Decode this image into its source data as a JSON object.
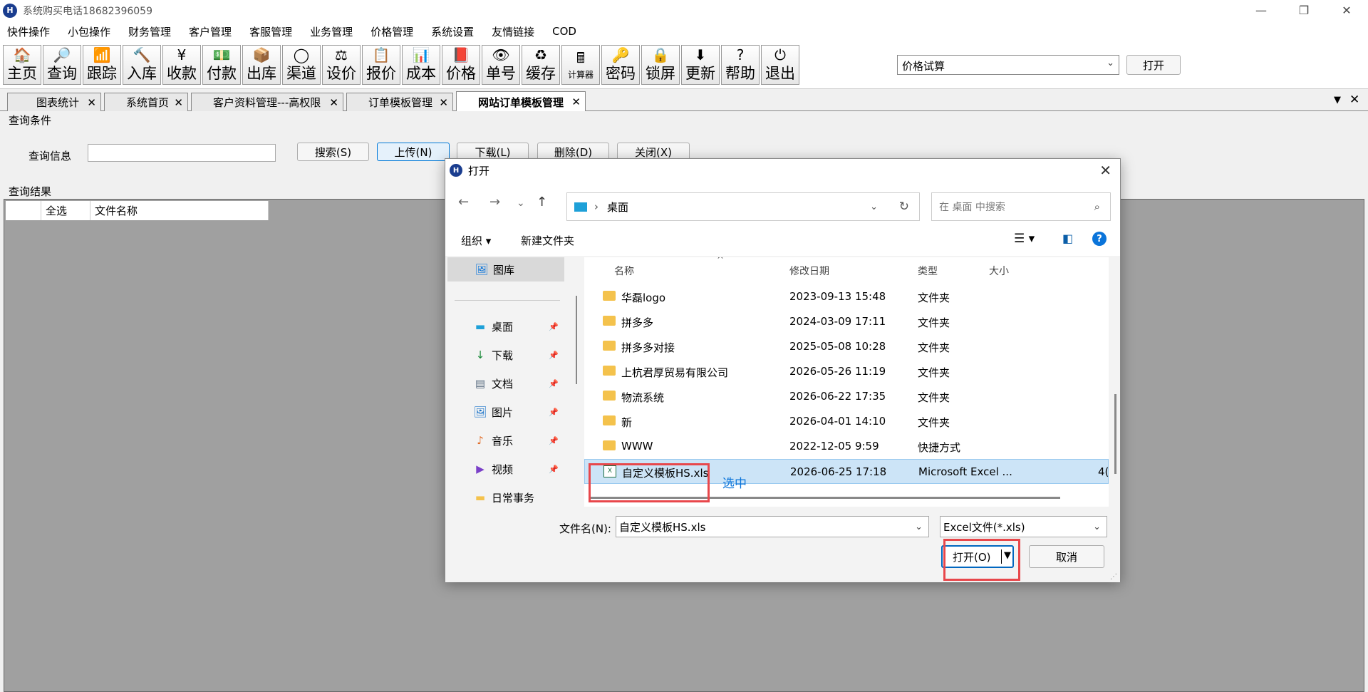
{
  "window": {
    "title": "系统购买电话18682396059",
    "logo": "H"
  },
  "menu": [
    "快件操作",
    "小包操作",
    "财务管理",
    "客户管理",
    "客服管理",
    "业务管理",
    "价格管理",
    "系统设置",
    "友情链接",
    "COD"
  ],
  "toolbar": {
    "buttons": [
      {
        "label": "主页",
        "icon": "house-icon",
        "glyph": "🏠"
      },
      {
        "label": "查询",
        "icon": "magnifier-icon",
        "glyph": "🔎"
      },
      {
        "label": "跟踪",
        "icon": "signal-icon",
        "glyph": "📶"
      },
      {
        "label": "入库",
        "icon": "hammer-icon",
        "glyph": "🔨"
      },
      {
        "label": "收款",
        "icon": "yen-icon",
        "glyph": "¥"
      },
      {
        "label": "付款",
        "icon": "money-icon",
        "glyph": "💵"
      },
      {
        "label": "出库",
        "icon": "box-icon",
        "glyph": "📦"
      },
      {
        "label": "渠道",
        "icon": "channel-icon",
        "glyph": "◯"
      },
      {
        "label": "设价",
        "icon": "scale-icon",
        "glyph": "⚖"
      },
      {
        "label": "报价",
        "icon": "quote-icon",
        "glyph": "📋"
      },
      {
        "label": "成本",
        "icon": "bar-chart-icon",
        "glyph": "📊"
      },
      {
        "label": "价格",
        "icon": "price-icon",
        "glyph": "📕"
      },
      {
        "label": "单号",
        "icon": "eye-icon",
        "glyph": "👁"
      },
      {
        "label": "缓存",
        "icon": "refresh-icon",
        "glyph": "♻"
      },
      {
        "label": "计算器",
        "icon": "calculator-icon",
        "glyph": "🖩"
      },
      {
        "label": "密码",
        "icon": "key-icon",
        "glyph": "🔑"
      },
      {
        "label": "锁屏",
        "icon": "lock-icon",
        "glyph": "🔒"
      },
      {
        "label": "更新",
        "icon": "download-arrow-icon",
        "glyph": "⬇"
      },
      {
        "label": "帮助",
        "icon": "help-icon",
        "glyph": "?"
      },
      {
        "label": "退出",
        "icon": "power-icon",
        "glyph": "⏻"
      }
    ],
    "combo_value": "价格试算",
    "open_button": "打开"
  },
  "tabs": [
    {
      "label": "图表统计"
    },
    {
      "label": "系统首页"
    },
    {
      "label": "客户资料管理---高权限"
    },
    {
      "label": "订单模板管理"
    },
    {
      "label": "网站订单模板管理"
    }
  ],
  "query": {
    "section_title": "查询条件",
    "info_label": "查询信息",
    "info_value": "",
    "buttons": [
      "搜索(S)",
      "上传(N)",
      "下载(L)",
      "删除(D)",
      "关闭(X)"
    ],
    "result_title": "查询结果",
    "columns": [
      "全选",
      "文件名称"
    ]
  },
  "dialog": {
    "title": "打开",
    "path": "桌面",
    "search_placeholder": "在 桌面 中搜索",
    "organize": "组织 ▾",
    "new_folder": "新建文件夹",
    "sidebar": [
      {
        "label": "图库",
        "icon": "gallery-icon",
        "glyph": "🖼",
        "pinned": false
      },
      {
        "label": "桌面",
        "icon": "desktop-icon",
        "glyph": "▬",
        "pinned": true
      },
      {
        "label": "下载",
        "icon": "download-icon",
        "glyph": "↓",
        "pinned": true
      },
      {
        "label": "文档",
        "icon": "document-icon",
        "glyph": "▤",
        "pinned": true
      },
      {
        "label": "图片",
        "icon": "picture-icon",
        "glyph": "🖼",
        "pinned": true
      },
      {
        "label": "音乐",
        "icon": "music-icon",
        "glyph": "♪",
        "pinned": true
      },
      {
        "label": "视频",
        "icon": "video-icon",
        "glyph": "▶",
        "pinned": true
      },
      {
        "label": "日常事务",
        "icon": "folder-icon",
        "glyph": "▬",
        "pinned": false
      }
    ],
    "columns": [
      "名称",
      "修改日期",
      "类型",
      "大小"
    ],
    "files": [
      {
        "name": "华磊logo",
        "date": "2023-09-13 15:48",
        "type": "文件夹",
        "size": ""
      },
      {
        "name": "拼多多",
        "date": "2024-03-09 17:11",
        "type": "文件夹",
        "size": ""
      },
      {
        "name": "拼多多对接",
        "date": "2025-05-08 10:28",
        "type": "文件夹",
        "size": ""
      },
      {
        "name": "上杭君厚贸易有限公司",
        "date": "2026-05-26 11:19",
        "type": "文件夹",
        "size": ""
      },
      {
        "name": "物流系统",
        "date": "2026-06-22 17:35",
        "type": "文件夹",
        "size": ""
      },
      {
        "name": "新",
        "date": "2026-04-01 14:10",
        "type": "文件夹",
        "size": ""
      },
      {
        "name": "WWW",
        "date": "2022-12-05 9:59",
        "type": "快捷方式",
        "size": ""
      },
      {
        "name": "自定义模板HS.xls",
        "date": "2026-06-25 17:18",
        "type": "Microsoft Excel ...",
        "size": "4("
      }
    ],
    "selected_note": "选中",
    "filename_label": "文件名(N):",
    "filename_value": "自定义模板HS.xls",
    "filter_value": "Excel文件(*.xls)",
    "open_button": "打开(O)",
    "cancel_button": "取消"
  },
  "colors": {
    "accent": "#0067c0",
    "highlight": "#e8474b",
    "selected_row": "#cce4f7"
  }
}
